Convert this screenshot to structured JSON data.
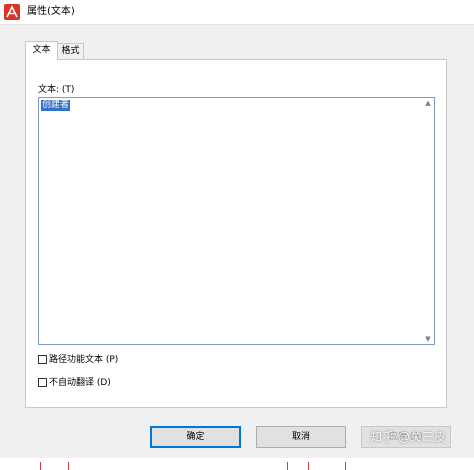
{
  "window": {
    "title": "属性(文本)",
    "app_icon": "pdf-app-icon"
  },
  "tabs": [
    {
      "label": "文本",
      "active": true
    },
    {
      "label": "格式",
      "active": false
    }
  ],
  "text_field": {
    "label": "文本: (T)",
    "value": "创建者"
  },
  "checkboxes": [
    {
      "label": "路径功能文本 (P)",
      "checked": false
    },
    {
      "label": "不自动翻译 (D)",
      "checked": false
    }
  ],
  "buttons": {
    "ok": "确定",
    "cancel": "取消",
    "apply": "应用 (A)"
  },
  "watermark": "知乎 @关三皮",
  "colors": {
    "selection": "#3372c8",
    "default_button_border": "#0078d7"
  }
}
